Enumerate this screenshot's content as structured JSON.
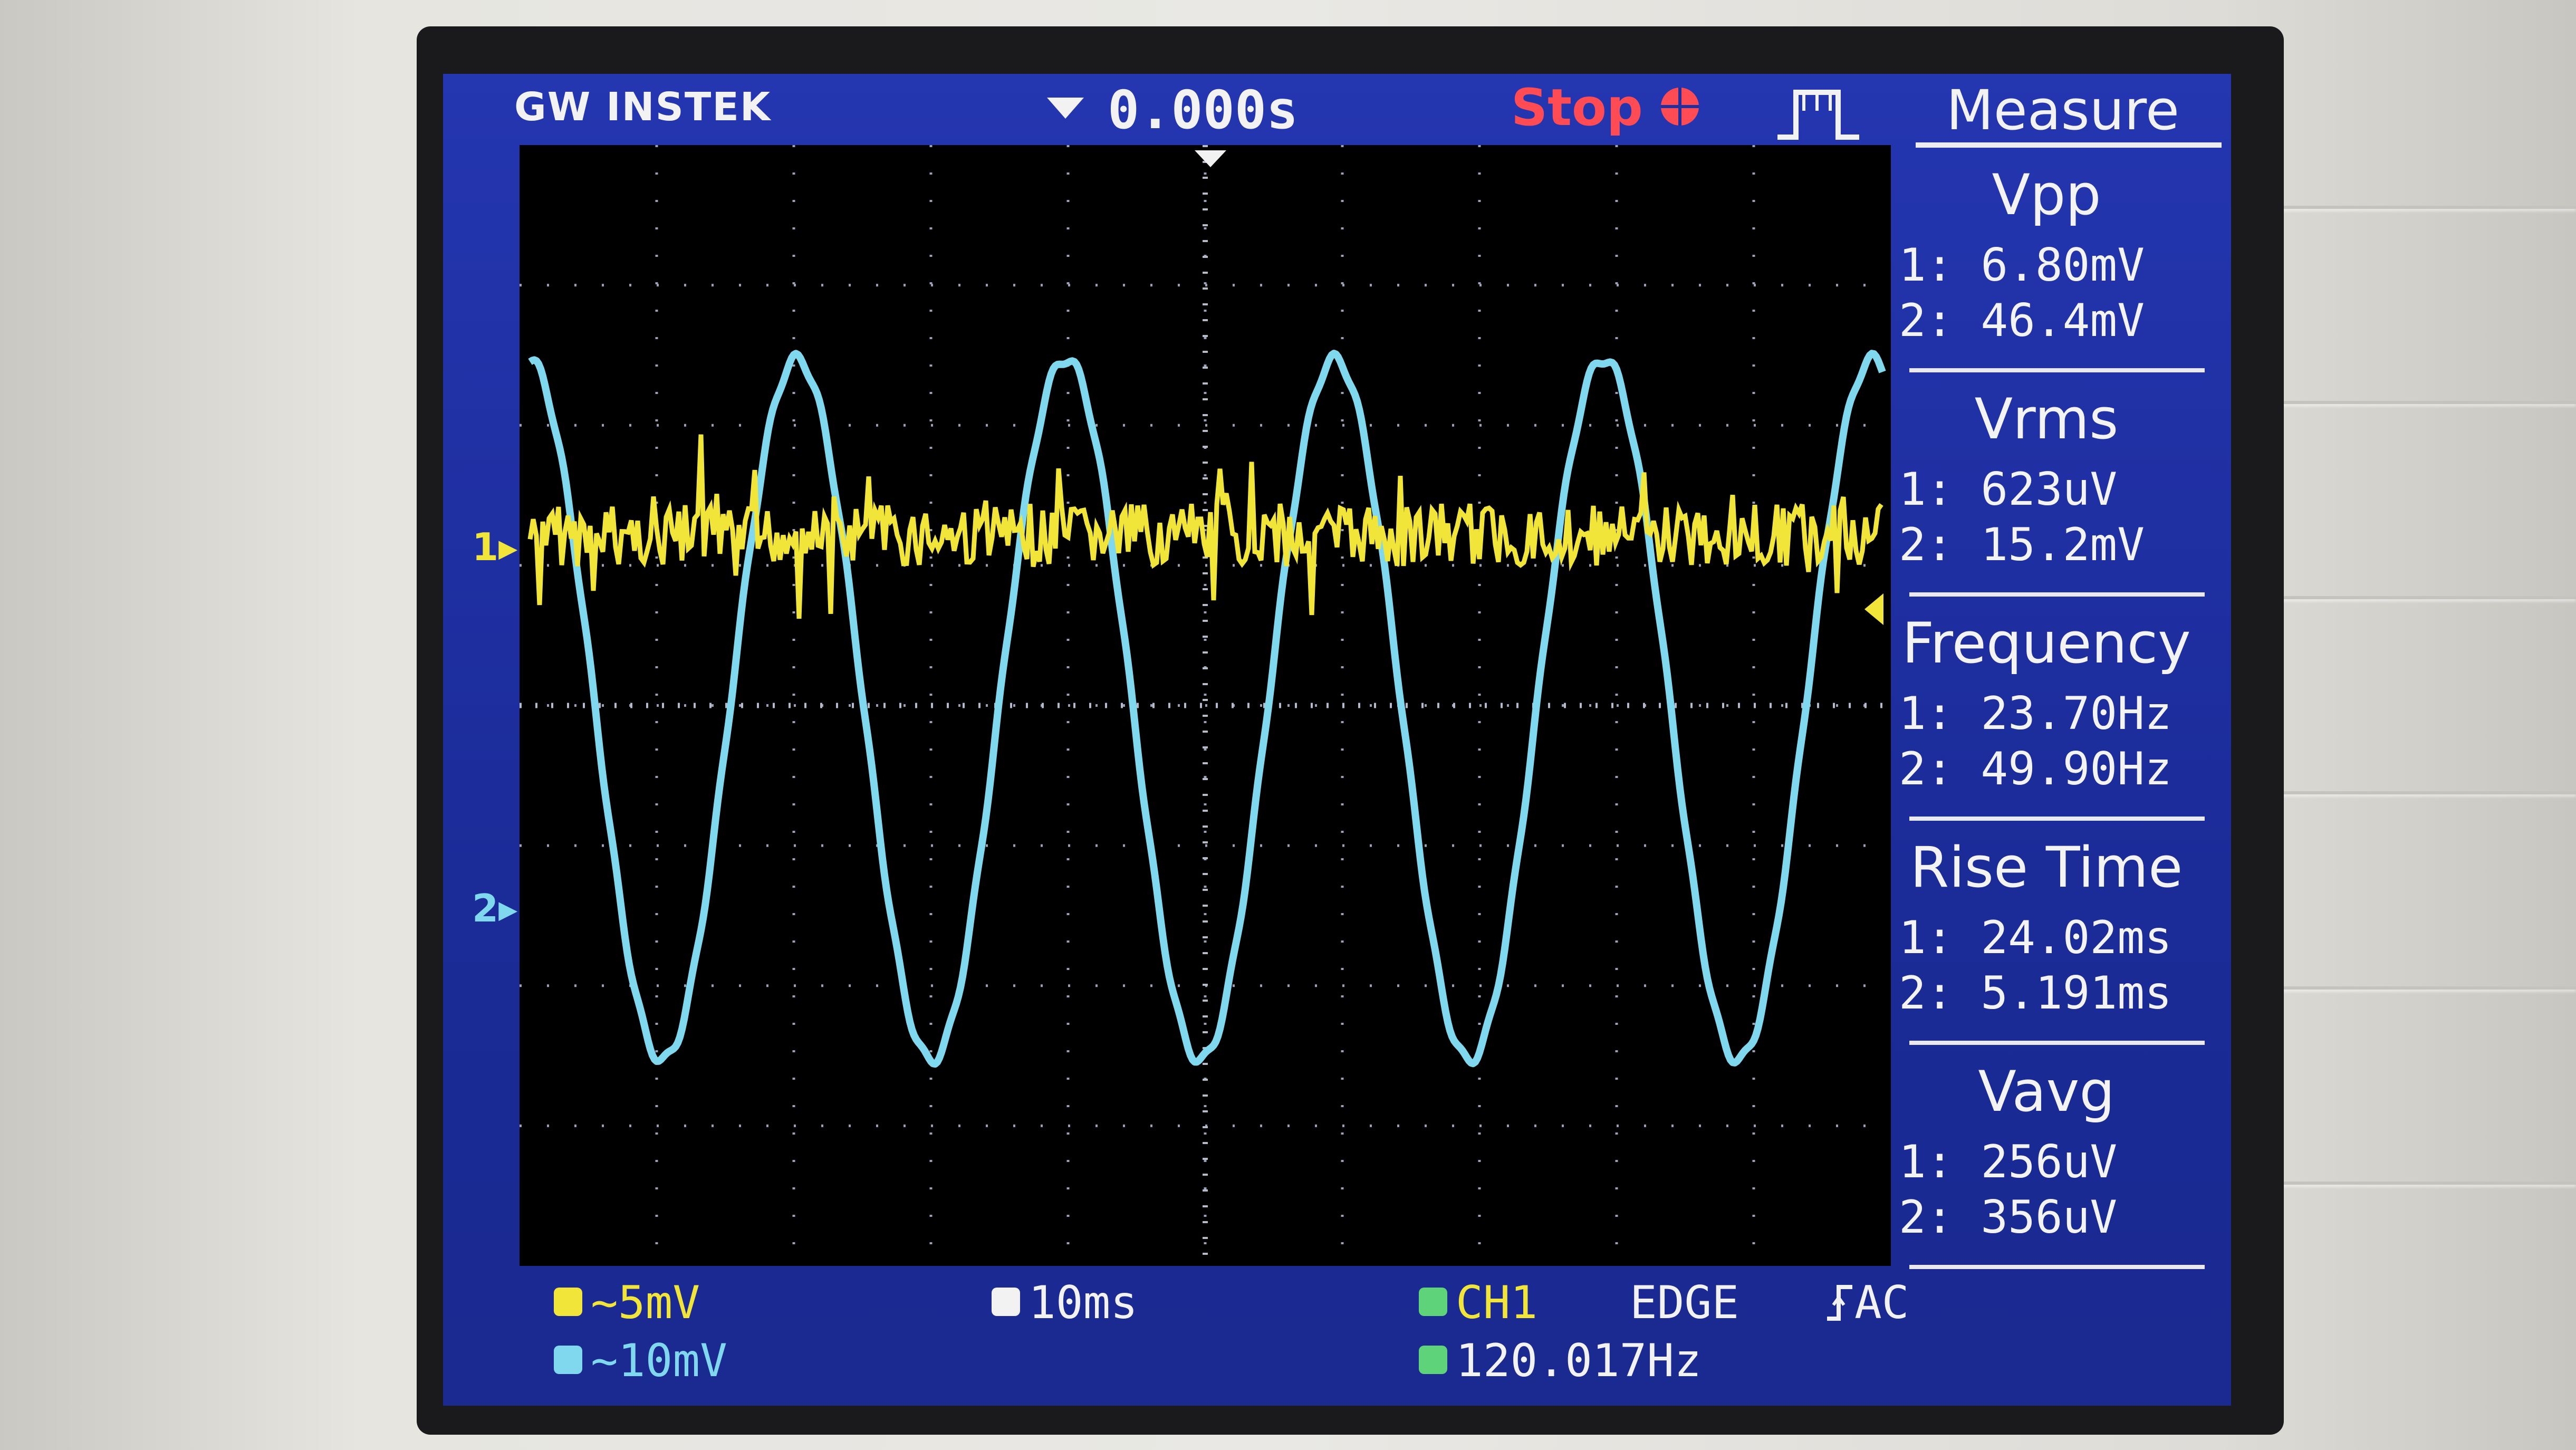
{
  "header": {
    "brand": "GW INSTEK",
    "time_offset": "0.000s",
    "run_status": "Stop",
    "menu_title": "Measure"
  },
  "channel_markers": {
    "ch1": "1",
    "ch2": "2"
  },
  "measurements": [
    {
      "name": "Vpp",
      "ch1": "1: 6.80mV",
      "ch2": "2: 46.4mV"
    },
    {
      "name": "Vrms",
      "ch1": "1: 623uV",
      "ch2": "2: 15.2mV"
    },
    {
      "name": "Frequency",
      "ch1": "1: 23.70Hz",
      "ch2": "2: 49.90Hz"
    },
    {
      "name": "Rise Time",
      "ch1": "1: 24.02ms",
      "ch2": "2: 5.191ms"
    },
    {
      "name": "Vavg",
      "ch1": "1: 256uV",
      "ch2": "2: 356uV"
    }
  ],
  "status_bar": {
    "ch1_scale": "~5mV",
    "ch2_scale": "~10mV",
    "timebase": "10ms",
    "trigger_source": "CH1",
    "trigger_type": "EDGE",
    "trigger_coupling": "AC",
    "trigger_frequency": "120.017Hz"
  },
  "colors": {
    "ch1": "#f2e53a",
    "ch2": "#7fd8ee",
    "stop": "#ff4b53",
    "screen_bg": "#1e2fa0"
  },
  "icons": {
    "run_status": "stop-indicator-icon",
    "trigger_edge": "rising-edge-icon",
    "pulse": "pulse-waveform-icon"
  }
}
